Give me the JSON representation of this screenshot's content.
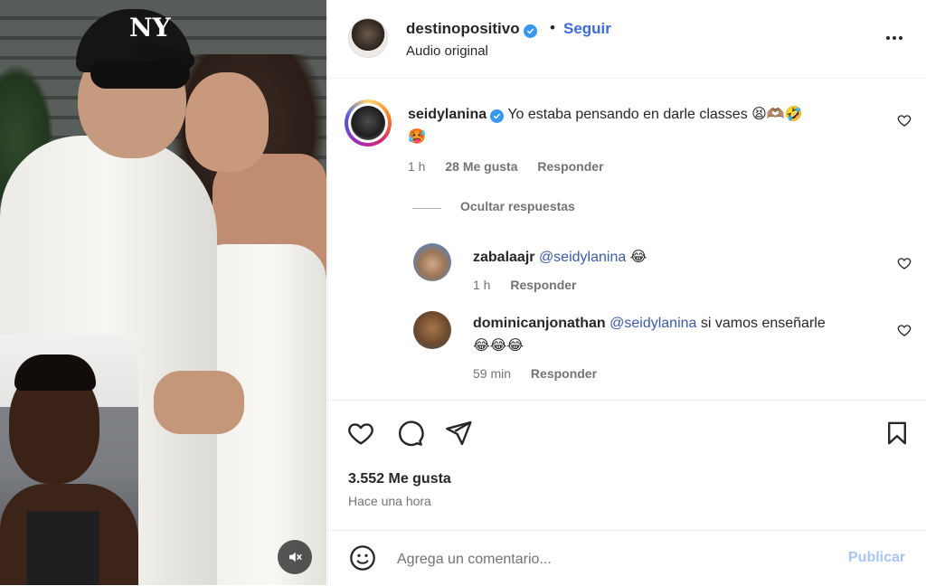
{
  "post": {
    "owner": "destinopositivo",
    "follow_label": "Seguir",
    "separator": "•",
    "audio_label": "Audio original",
    "likes": "3.552 Me gusta",
    "time_ago": "Hace una hora"
  },
  "comment": {
    "user": "seidylanina",
    "text": "Yo estaba pensando en darle classes",
    "emojis_line1": "😫🫶🏽🤣",
    "emojis_line2": "🥵",
    "time": "1 h",
    "likes": "28 Me gusta",
    "reply_label": "Responder"
  },
  "hide_replies_label": "Ocultar respuestas",
  "replies": [
    {
      "user": "zabalaajr",
      "mention": "@seidylanina",
      "text": "",
      "emojis": "😂",
      "time": "1 h",
      "reply_label": "Responder"
    },
    {
      "user": "dominicanjonathan",
      "mention": "@seidylanina",
      "text": "si vamos enseñarle",
      "emojis": "😂😂😂",
      "time": "59 min",
      "reply_label": "Responder"
    }
  ],
  "composer": {
    "placeholder": "Agrega un comentario...",
    "publish_label": "Publicar"
  },
  "media": {
    "cap_logo": "NY"
  },
  "colors": {
    "accent": "#3d6ae0",
    "verified": "#3897f0",
    "muted_text": "#737373",
    "publish_disabled": "#a7c6f7"
  },
  "icons": [
    "verified-badge-icon",
    "more-options-icon",
    "heart-icon",
    "comment-icon",
    "share-icon",
    "bookmark-icon",
    "emoji-icon",
    "mute-icon"
  ]
}
